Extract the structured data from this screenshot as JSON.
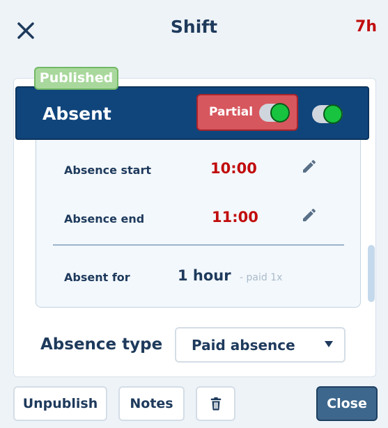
{
  "header": {
    "title": "Shift",
    "hours": "7h"
  },
  "absence": {
    "status_badge": "Published",
    "label": "Absent",
    "partial_label": "Partial",
    "partial_on": true,
    "absent_on": true,
    "start_label": "Absence start",
    "start_value": "10:00",
    "end_label": "Absence end",
    "end_value": "11:00",
    "absent_for_label": "Absent for",
    "absent_for_value": "1 hour",
    "paid_note": "- paid 1x"
  },
  "absence_type": {
    "label": "Absence type",
    "selected": "Paid absence"
  },
  "footer": {
    "unpublish": "Unpublish",
    "notes": "Notes",
    "close": "Close"
  },
  "icons": {
    "close": "close-icon",
    "edit": "pencil-icon",
    "delete": "trash-icon",
    "dropdown": "caret-down-icon"
  },
  "colors": {
    "primary": "#10457c",
    "danger_text": "#c10d0d",
    "partial_bg": "#d7575e",
    "badge_bg": "#a9d89d",
    "toggle_on": "#18c43f",
    "close_button": "#3e678d"
  }
}
